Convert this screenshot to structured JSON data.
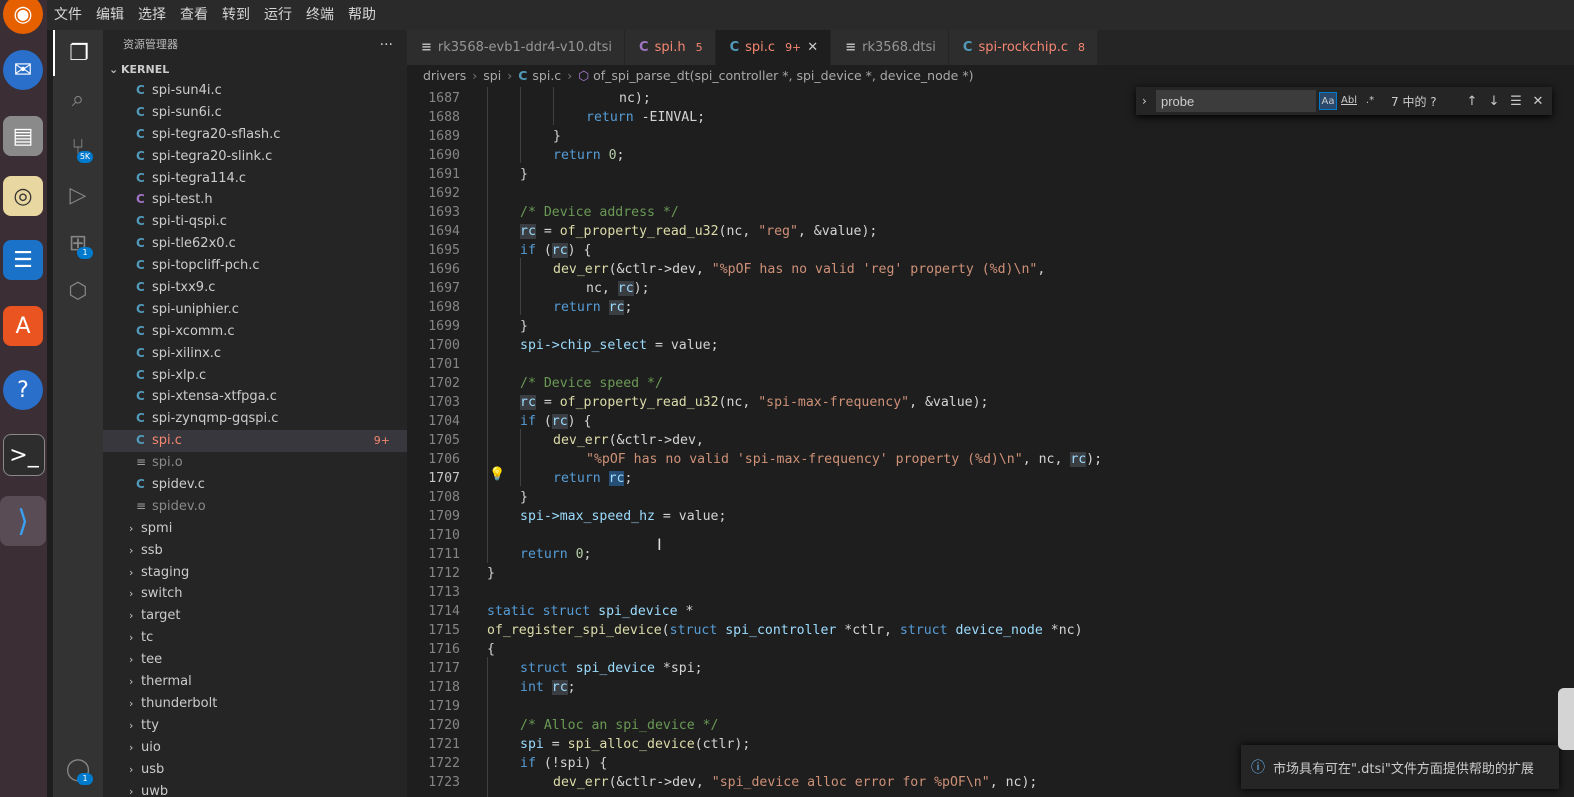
{
  "menu": [
    "文件",
    "编辑",
    "选择",
    "查看",
    "转到",
    "运行",
    "终端",
    "帮助"
  ],
  "dock_icons": [
    "firefox-icon",
    "thunderbird-icon",
    "files-icon",
    "rhythmbox-icon",
    "writer-icon",
    "software-icon",
    "help-icon",
    "terminal-icon",
    "vscode-icon"
  ],
  "activity": {
    "scm_badge": "5K",
    "ext_badge": "1",
    "account_badge": "1"
  },
  "sidebar": {
    "title": "资源管理器",
    "more": "···",
    "section": "KERNEL",
    "files": [
      {
        "icon": "C",
        "name": "spi-sun4i.c"
      },
      {
        "icon": "C",
        "name": "spi-sun6i.c"
      },
      {
        "icon": "C",
        "name": "spi-tegra20-sflash.c"
      },
      {
        "icon": "C",
        "name": "spi-tegra20-slink.c"
      },
      {
        "icon": "C",
        "name": "spi-tegra114.c"
      },
      {
        "icon": "C",
        "name": "spi-test.h"
      },
      {
        "icon": "C",
        "name": "spi-ti-qspi.c"
      },
      {
        "icon": "C",
        "name": "spi-tle62x0.c"
      },
      {
        "icon": "C",
        "name": "spi-topcliff-pch.c"
      },
      {
        "icon": "C",
        "name": "spi-txx9.c"
      },
      {
        "icon": "C",
        "name": "spi-uniphier.c"
      },
      {
        "icon": "C",
        "name": "spi-xcomm.c"
      },
      {
        "icon": "C",
        "name": "spi-xilinx.c"
      },
      {
        "icon": "C",
        "name": "spi-xlp.c"
      },
      {
        "icon": "C",
        "name": "spi-xtensa-xtfpga.c"
      },
      {
        "icon": "C",
        "name": "spi-zynqmp-gqspi.c"
      },
      {
        "icon": "C",
        "name": "spi.c",
        "badge": "9+"
      },
      {
        "icon": "≡",
        "name": "spi.o"
      },
      {
        "icon": "C",
        "name": "spidev.c"
      },
      {
        "icon": "≡",
        "name": "spidev.o"
      }
    ],
    "folders": [
      "spmi",
      "ssb",
      "staging",
      "switch",
      "target",
      "tc",
      "tee",
      "thermal",
      "thunderbolt",
      "tty",
      "uio",
      "usb",
      "uwb"
    ]
  },
  "tabs": [
    {
      "icon": "≡",
      "label": "rk3568-evb1-ddr4-v10.dtsi"
    },
    {
      "icon": "C",
      "label": "spi.h",
      "badge": "5"
    },
    {
      "icon": "C",
      "label": "spi.c",
      "badge": "9+",
      "close": "✕"
    },
    {
      "icon": "≡",
      "label": "rk3568.dtsi"
    },
    {
      "icon": "C",
      "label": "spi-rockchip.c",
      "badge": "8"
    }
  ],
  "breadcrumb": {
    "p1": "drivers",
    "p2": "spi",
    "p3_icon": "C",
    "p3": "spi.c",
    "p4": "of_spi_parse_dt(spi_controller *, spi_device *, device_node *)"
  },
  "find": {
    "value": "probe",
    "opt_case": "Aa",
    "opt_word": "Abl",
    "opt_regex": ".*",
    "count": "7 中的 ?"
  },
  "lines": [
    "1687",
    "1688",
    "1689",
    "1690",
    "1691",
    "1692",
    "1693",
    "1694",
    "1695",
    "1696",
    "1697",
    "1698",
    "1699",
    "1700",
    "1701",
    "1702",
    "1703",
    "1704",
    "1705",
    "1706",
    "1707",
    "1708",
    "1709",
    "1710",
    "1711",
    "1712",
    "1713",
    "1714",
    "1715",
    "1716",
    "1717",
    "1718",
    "1719",
    "1720",
    "1721",
    "1722",
    "1723"
  ],
  "code": {
    "l1687": "nc);",
    "l1688a": "return ",
    "l1688b": "-EINVAL;",
    "l1689": "}",
    "l1690a": "return ",
    "l1690b": "0",
    "l1690c": ";",
    "l1691": "}",
    "l1693": "/* Device address */",
    "l1694a": "rc",
    "l1694b": " = ",
    "l1694c": "of_property_read_u32",
    "l1694d": "(nc, ",
    "l1694e": "\"reg\"",
    "l1694f": ", &value);",
    "l1695a": "if",
    "l1695b": " (",
    "l1695c": "rc",
    "l1695d": ") {",
    "l1696a": "dev_err",
    "l1696b": "(&ctlr->dev, ",
    "l1696c": "\"%pOF has no valid 'reg' property (%d)\\n\"",
    "l1696d": ",",
    "l1697a": "nc, ",
    "l1697b": "rc",
    "l1697c": ");",
    "l1698a": "return ",
    "l1698b": "rc",
    "l1698c": ";",
    "l1699": "}",
    "l1700a": "spi->chip_select",
    "l1700b": " = value;",
    "l1702": "/* Device speed */",
    "l1703a": "rc",
    "l1703b": " = ",
    "l1703c": "of_property_read_u32",
    "l1703d": "(nc, ",
    "l1703e": "\"spi-max-frequency\"",
    "l1703f": ", &value);",
    "l1704a": "if",
    "l1704b": " (",
    "l1704c": "rc",
    "l1704d": ") {",
    "l1705a": "dev_err",
    "l1705b": "(&ctlr->dev,",
    "l1706a": "\"%pOF has no valid 'spi-max-frequency' property (%d)\\n\"",
    "l1706b": ", nc, ",
    "l1706c": "rc",
    "l1706d": ");",
    "l1707a": "return ",
    "l1707b": "rc",
    "l1707c": ";",
    "l1708": "}",
    "l1709a": "spi->max_speed_hz",
    "l1709b": " = value;",
    "l1711a": "return ",
    "l1711b": "0",
    "l1711c": ";",
    "l1712": "}",
    "l1714a": "static struct ",
    "l1714b": "spi_device",
    "l1714c": " *",
    "l1715a": "of_register_spi_device",
    "l1715b": "(",
    "l1715c": "struct ",
    "l1715d": "spi_controller",
    "l1715e": " *ctlr, ",
    "l1715f": "struct ",
    "l1715g": "device_node",
    "l1715h": " *nc)",
    "l1716": "{",
    "l1717a": "struct ",
    "l1717b": "spi_device",
    "l1717c": " *spi;",
    "l1718a": "int ",
    "l1718b": "rc",
    "l1718c": ";",
    "l1720": "/* Alloc an spi_device */",
    "l1721a": "spi",
    "l1721b": " = ",
    "l1721c": "spi_alloc_device",
    "l1721d": "(ctlr);",
    "l1722a": "if",
    "l1722b": " (!spi) {",
    "l1723a": "dev_err",
    "l1723b": "(&ctlr->dev, ",
    "l1723c": "\"spi_device alloc error for %pOF\\n\"",
    "l1723d": ", nc);"
  },
  "notification": "市场具有可在\".dtsi\"文件方面提供帮助的扩展",
  "colors": {
    "accent": "#007acc",
    "error": "#f48771",
    "keyword": "#569cd6",
    "string": "#ce9178",
    "comment": "#6a9955",
    "function": "#dcdcaa"
  }
}
